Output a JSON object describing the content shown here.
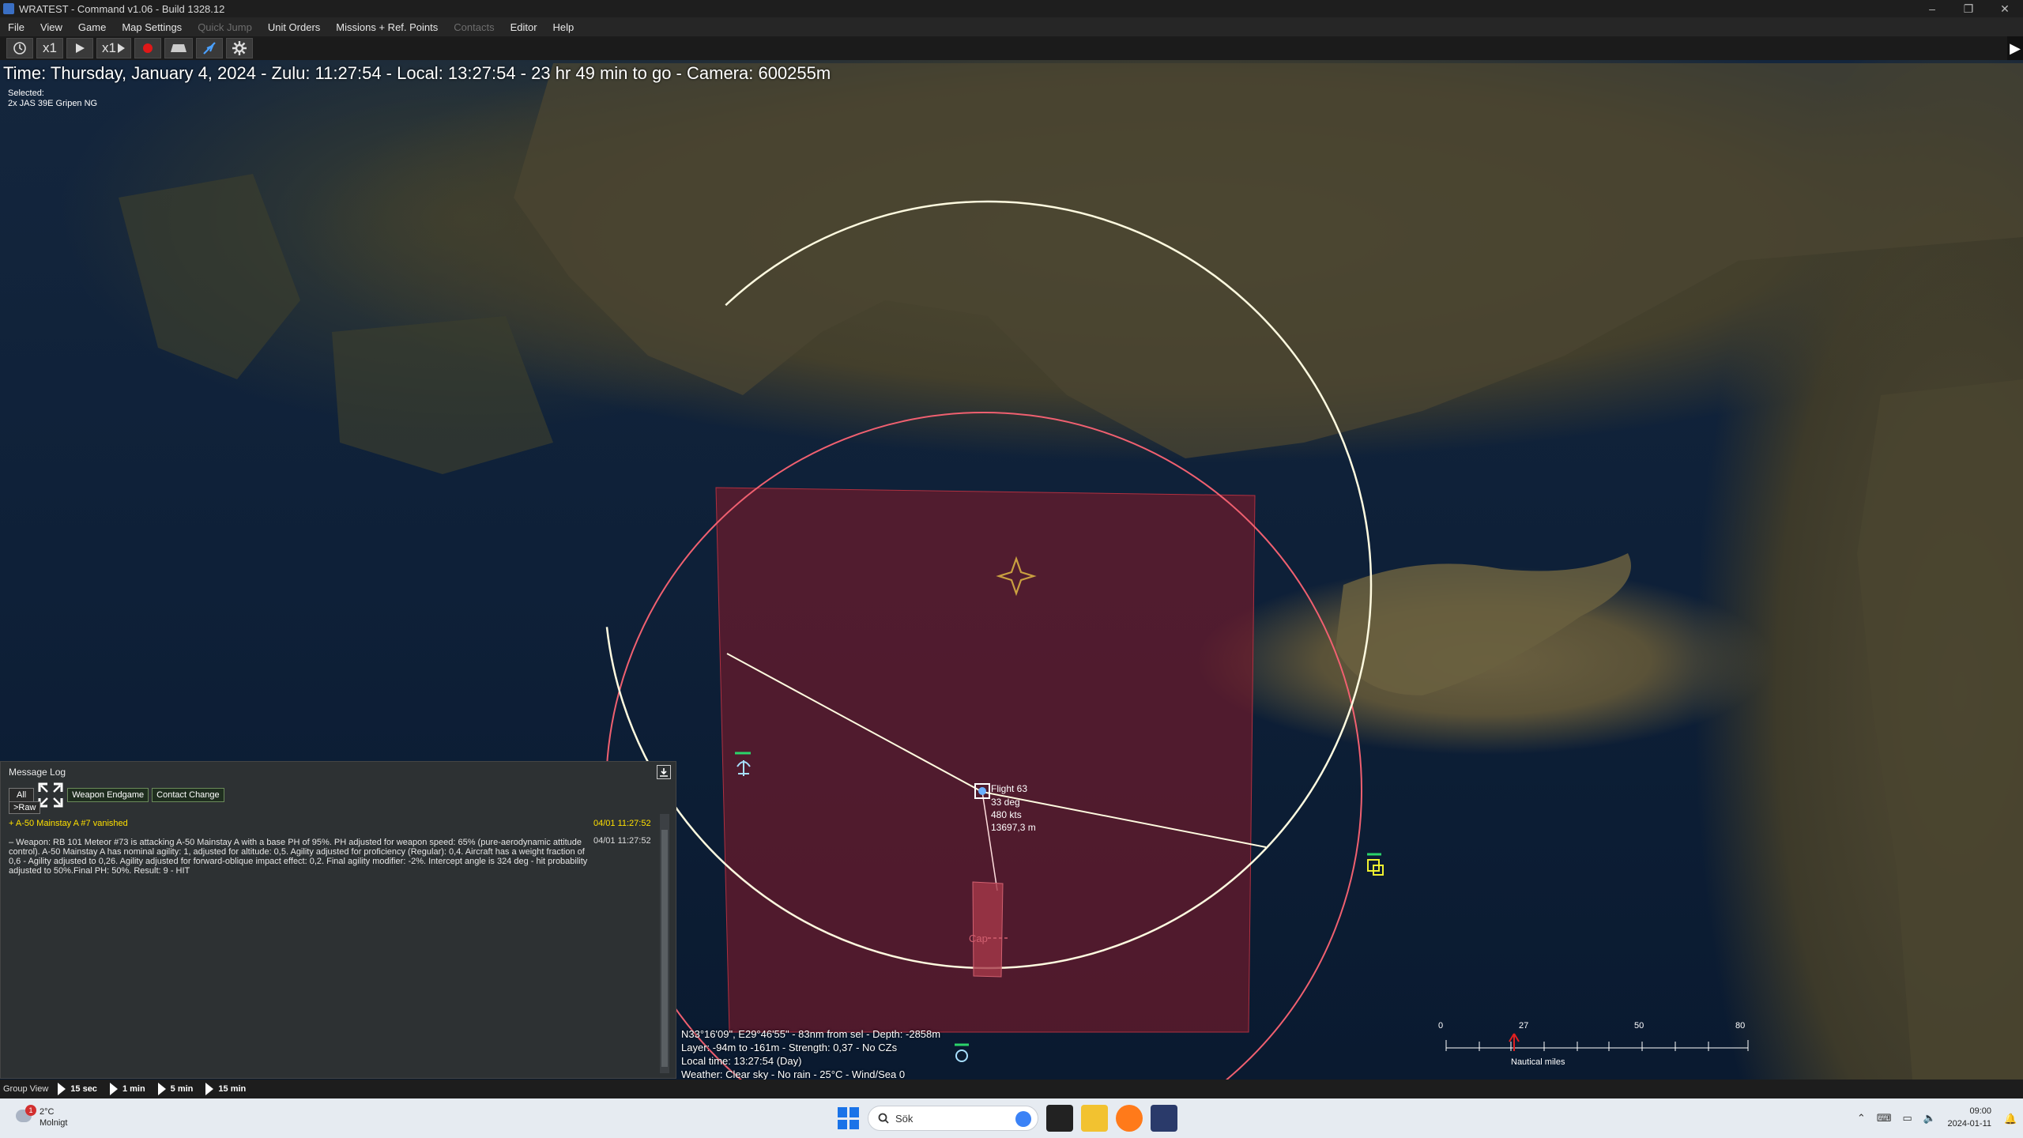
{
  "window": {
    "title": "WRATEST - Command v1.06 - Build 1328.12",
    "controls": [
      "–",
      "❐",
      "✕"
    ]
  },
  "menu": {
    "items": [
      {
        "label": "File",
        "enabled": true
      },
      {
        "label": "View",
        "enabled": true
      },
      {
        "label": "Game",
        "enabled": true
      },
      {
        "label": "Map Settings",
        "enabled": true
      },
      {
        "label": "Quick Jump",
        "enabled": false
      },
      {
        "label": "Unit Orders",
        "enabled": true
      },
      {
        "label": "Missions + Ref. Points",
        "enabled": true
      },
      {
        "label": "Contacts",
        "enabled": false
      },
      {
        "label": "Editor",
        "enabled": true
      },
      {
        "label": "Help",
        "enabled": true
      }
    ]
  },
  "toolbar": {
    "clock_icon": "clock-icon",
    "time_compression": "x1",
    "play_icon": "play-icon",
    "step": "x1",
    "record_icon": "record-icon",
    "unit_icon": "unit-icon",
    "plane_icon": "plane-icon",
    "settings_icon": "gear-icon"
  },
  "status": {
    "time_line": "Time: Thursday, January 4, 2024 - Zulu: 11:27:54 - Local: 13:27:54 - 23 hr 49 min to go -  Camera: 600255m",
    "selected_label": "Selected:",
    "selected_unit": "2x JAS 39E Gripen NG"
  },
  "map": {
    "flight_label": "Flight 63",
    "flight_heading": "33 deg",
    "flight_speed": "480 kts",
    "flight_alt": "13697,3 m",
    "cap_label": "Cap",
    "colors": {
      "range_white": "#fffbe0",
      "range_red": "#f06070",
      "zone_fill": "#7a1a2a",
      "target_marker": "#c9a040"
    }
  },
  "message_log": {
    "title": "Message Log",
    "filters": {
      "all": "All",
      "weapon_endgame": "Weapon Endgame",
      "contact_change": "Contact Change",
      "raw": ">Raw"
    },
    "entries": [
      {
        "text": "+ A-50 Mainstay A #7 vanished",
        "time": "04/01 11:27:52",
        "color": "#ffe000"
      },
      {
        "text": "– Weapon: RB 101 Meteor #73 is attacking A-50 Mainstay A with a base PH of 95%. PH adjusted for weapon speed: 65% (pure-aerodynamic attitude control). A-50 Mainstay A has nominal agility: 1, adjusted for altitude: 0,5. Agility adjusted for proficiency (Regular): 0,4. Aircraft has a weight fraction of 0,6 - Agility adjusted to 0,26. Agility adjusted for forward-oblique impact effect: 0,2. Final agility modifier: -2%. Intercept angle is 324 deg - hit probability adjusted to 50%.Final PH: 50%. Result: 9 - HIT",
        "time": "04/01 11:27:52",
        "color": "#e6e6e6"
      }
    ]
  },
  "cursor_info": {
    "line1": "N33°16'09\", E29°46'55\" - 83nm from sel - Depth: -2858m",
    "line2": "Layer: -94m to -161m - Strength: 0,37 - No CZs",
    "line3": "Local time: 13:27:54 (Day)",
    "line4": "Weather: Clear sky - No rain - 25°C - Wind/Sea 0"
  },
  "scale": {
    "labels": [
      "0",
      "27",
      "50",
      "80"
    ],
    "unit": "Nautical miles"
  },
  "group_view": {
    "label": "Group View",
    "buttons": [
      "15 sec",
      "1 min",
      "5 min",
      "15 min"
    ]
  },
  "taskbar": {
    "temperature": "2°C",
    "weather_text": "Molnigt",
    "weather_badge": "1",
    "search_placeholder": "Sök",
    "time": "09:00",
    "date": "2024-01-11"
  }
}
